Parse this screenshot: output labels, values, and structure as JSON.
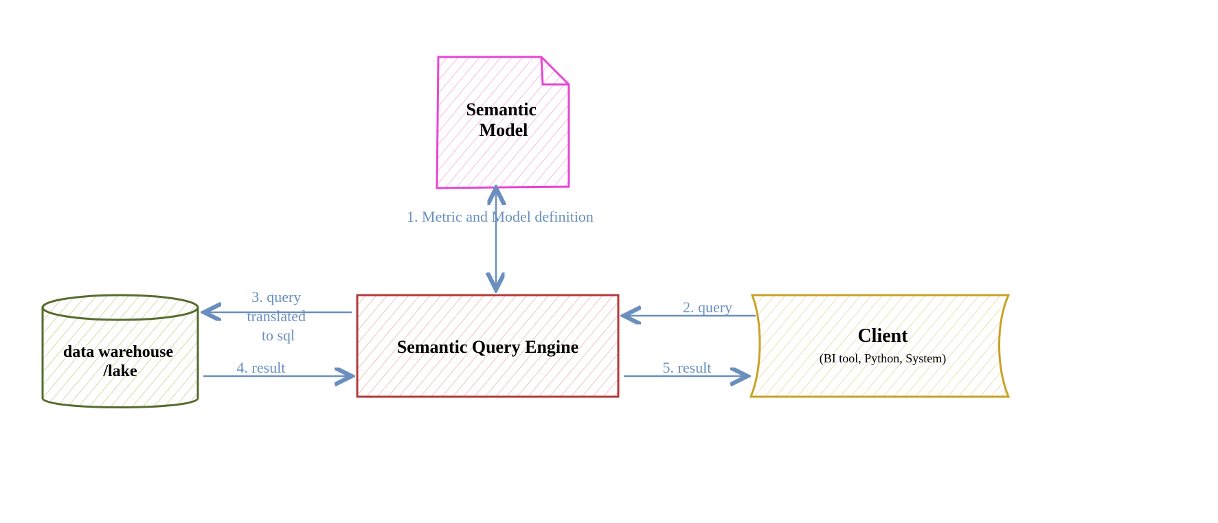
{
  "nodes": {
    "semantic_model": {
      "label": "Semantic\nModel"
    },
    "engine": {
      "label": "Semantic Query Engine"
    },
    "dw": {
      "label": "data warehouse\n/lake"
    },
    "client": {
      "label": "Client",
      "sub": "(BI tool, Python, System)"
    }
  },
  "edges": {
    "e1": "1. Metric and Model definition",
    "e2": "2. query",
    "e3": "3. query\ntranslated\nto sql",
    "e4": "4. result",
    "e5": "5. result"
  },
  "colors": {
    "magenta": "#e646d6",
    "red": "#b33a3a",
    "olive": "#556b2f",
    "gold": "#c9a227",
    "edge": "#6a8fbf"
  }
}
